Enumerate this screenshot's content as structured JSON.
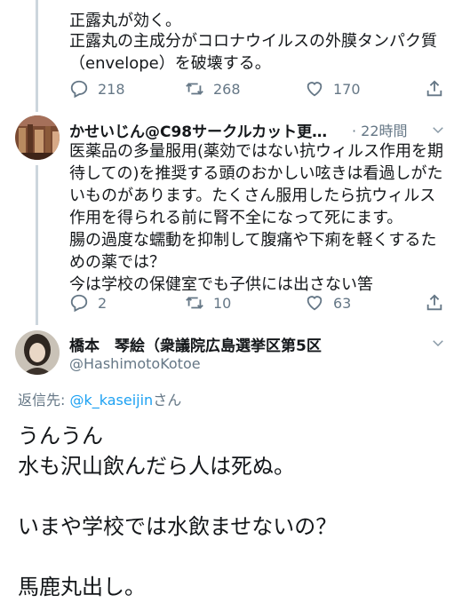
{
  "prev_tweet": {
    "line1": "正露丸が効く。",
    "body": "正露丸の主成分がコロナウイルスの外膜タンパク質\n（envelope）を破壊する。",
    "replies": "218",
    "retweets": "268",
    "likes": "170"
  },
  "reply_tweet": {
    "display_name": "かせいじん@C98サークルカット更…",
    "time": "· 22時間",
    "body": "医薬品の多量服用(薬効ではない抗ウィルス作用を期待しての)を推奨する頭のおかしい呟きは看過しがたいものがあります。たくさん服用したら抗ウィルス作用を得られる前に腎不全になって死にます。\n腸の過度な蠕動を抑制して腹痛や下痢を軽くするための薬では？\n今は学校の保健室でも子供には出さない筈",
    "replies": "2",
    "retweets": "10",
    "likes": "63"
  },
  "main_tweet": {
    "display_name": "橋本　琴絵（衆議院広島選挙区第5区",
    "handle": "@HashimotoKotoe",
    "reply_prefix": "返信先: ",
    "reply_to": "@k_kaseijin",
    "reply_suffix": "さん",
    "body": "うんうん\n水も沢山飲んだら人は死ぬ。\n\nいまや学校では水飲ませないの？\n\n馬鹿丸出し。"
  },
  "colors": {
    "link": "#1da1f2",
    "secondary": "#657786",
    "text": "#14171a",
    "thread_line": "#ccd6dd"
  }
}
